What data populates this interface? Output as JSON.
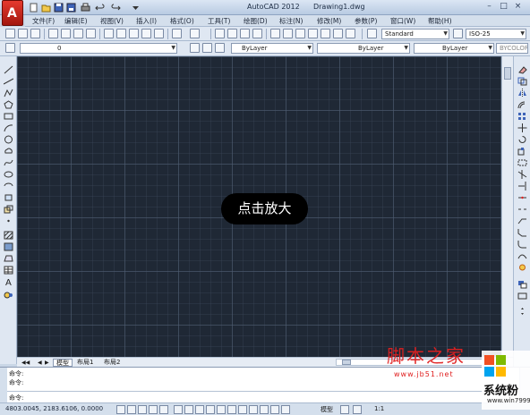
{
  "window": {
    "app_title": "AutoCAD 2012",
    "document": "Drawing1.dwg",
    "controls": [
      "–",
      "□",
      "×"
    ]
  },
  "menu": [
    "文件(F)",
    "编辑(E)",
    "视图(V)",
    "插入(I)",
    "格式(O)",
    "工具(T)",
    "绘图(D)",
    "标注(N)",
    "修改(M)",
    "参数(P)",
    "窗口(W)",
    "帮助(H)"
  ],
  "toolbar": {
    "text_style": "Standard",
    "dim_style": "ISO-25"
  },
  "layers": {
    "current_layer": "0",
    "color": "ByLayer",
    "linetype": "ByLayer",
    "lineweight": "ByLayer",
    "plot_style": "BYCOLOR"
  },
  "layout_tabs": [
    "模型",
    "布局1",
    "布局2"
  ],
  "zoom_hint": "点击放大",
  "command": {
    "line1": "命令:",
    "line2": "命令:",
    "prompt": "命令:"
  },
  "status": {
    "coordinates": "4803.0045, 2183.6106, 0.0000",
    "model_label": "模型",
    "scale": "1:1"
  },
  "watermark": {
    "script_text": "脚本之家",
    "url": "www.jb51.net",
    "brand": "系统粉",
    "site": "www.win7999.com"
  },
  "colors": {
    "canvas": "#1f2835",
    "accent_red": "#e53a2e"
  }
}
